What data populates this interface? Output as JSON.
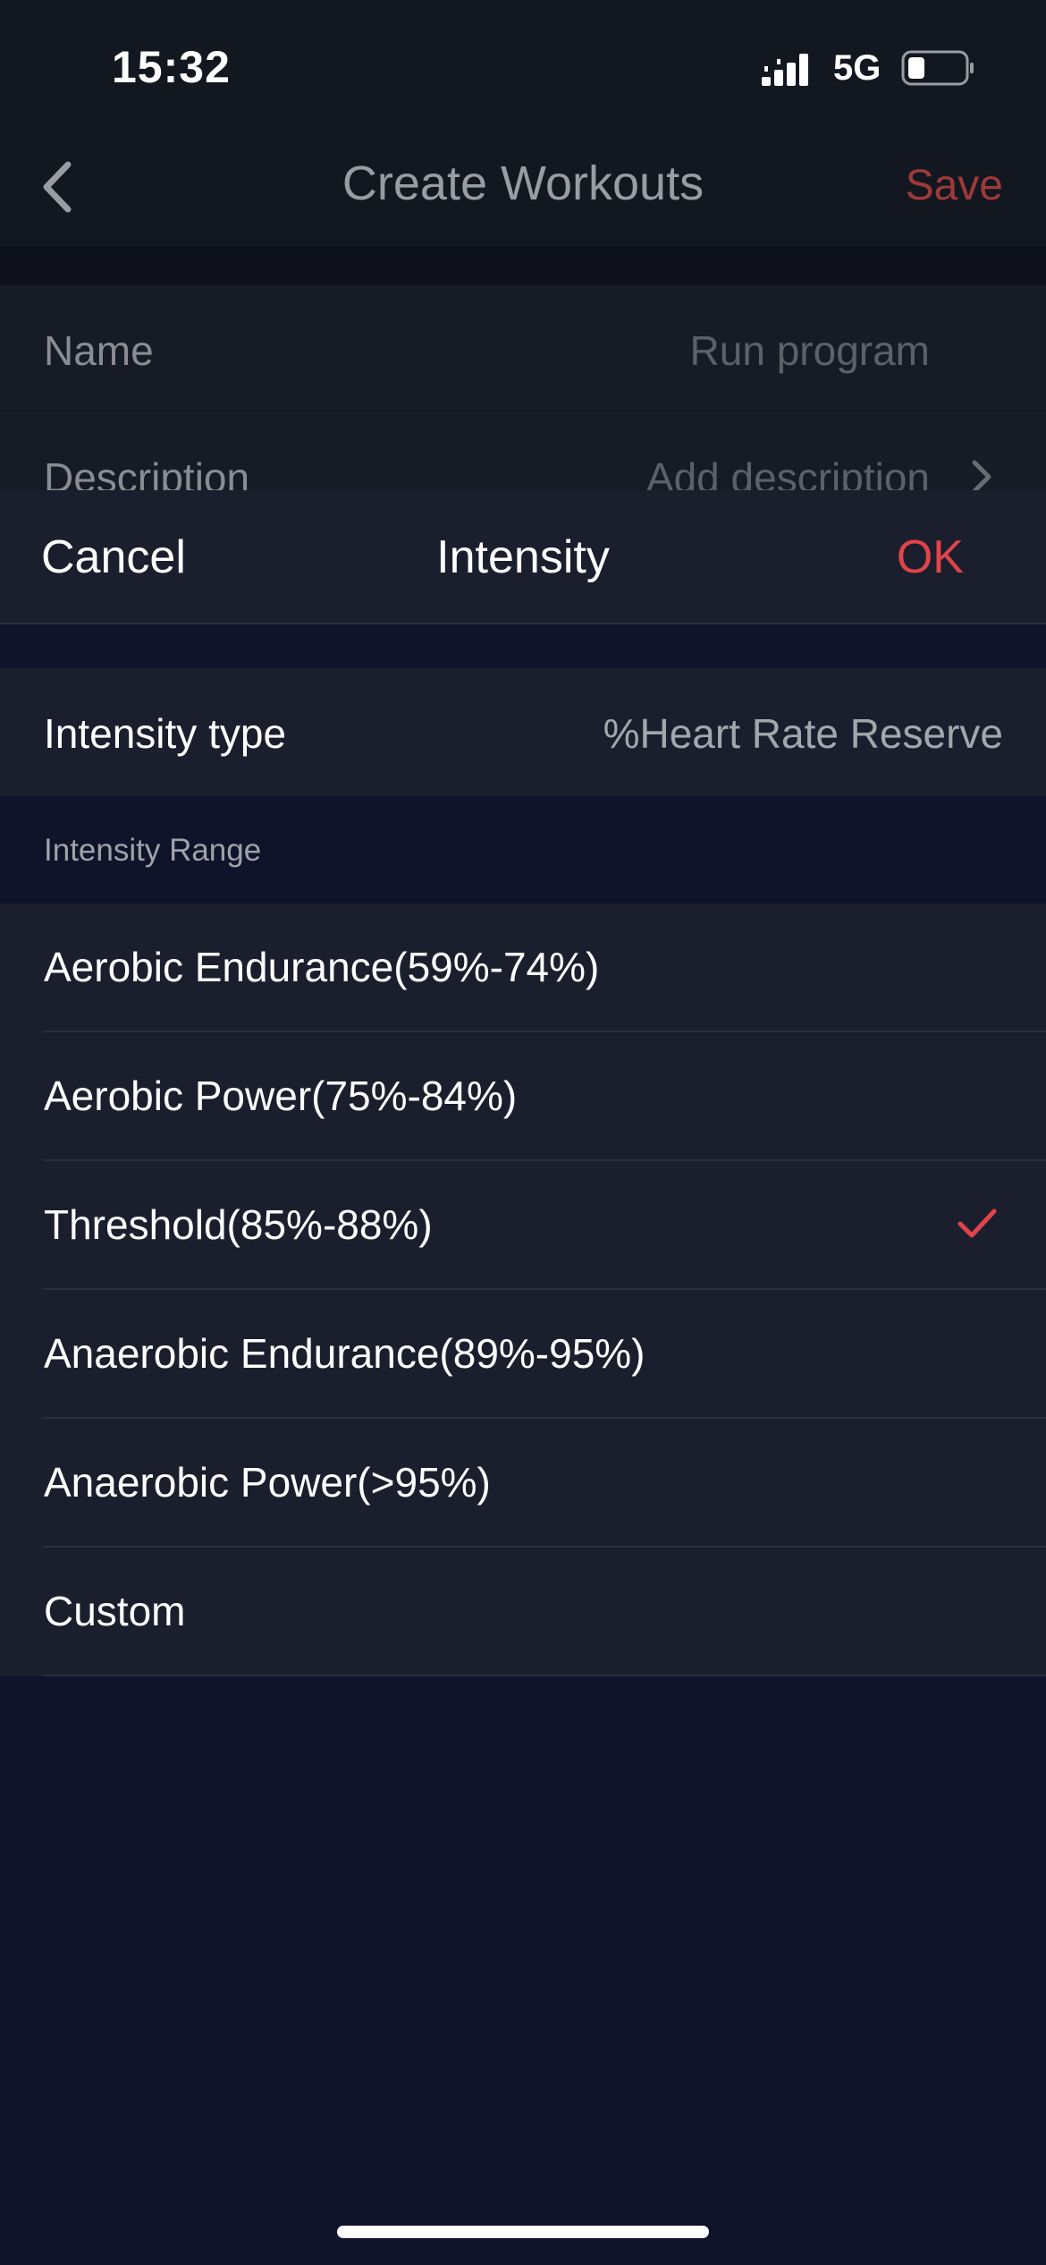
{
  "status_bar": {
    "time": "15:32",
    "network": "5G"
  },
  "nav": {
    "title": "Create Workouts",
    "save_label": "Save"
  },
  "background_form": {
    "rows": [
      {
        "label": "Name",
        "value": "Run program"
      },
      {
        "label": "Description",
        "value": "Add description"
      }
    ]
  },
  "sheet": {
    "cancel_label": "Cancel",
    "title": "Intensity",
    "ok_label": "OK",
    "intensity_type": {
      "label": "Intensity type",
      "value": "%Heart Rate Reserve"
    },
    "range_section_label": "Intensity Range",
    "options": [
      {
        "label": "Aerobic Endurance(59%-74%)",
        "selected": false
      },
      {
        "label": "Aerobic Power(75%-84%)",
        "selected": false
      },
      {
        "label": "Threshold(85%-88%)",
        "selected": true
      },
      {
        "label": "Anaerobic Endurance(89%-95%)",
        "selected": false
      },
      {
        "label": "Anaerobic Power(>95%)",
        "selected": false
      },
      {
        "label": "Custom",
        "selected": false
      }
    ]
  },
  "colors": {
    "accent": "#e2434b",
    "sheet_background": "#1b1f2d",
    "page_background": "#10142a"
  }
}
